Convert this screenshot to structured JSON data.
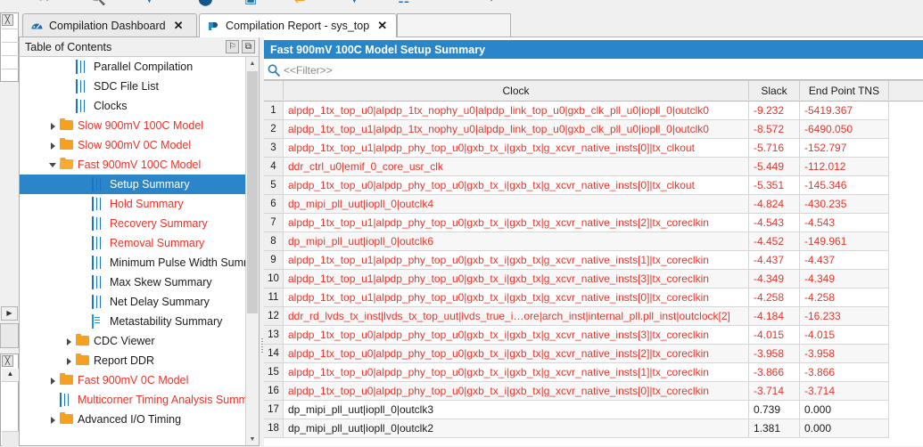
{
  "toolbar": {
    "icons": [
      "cursor-icon",
      "zoom-icon",
      "down-arrow-icon",
      "circle-icon",
      "chart-icon",
      "compare-icon",
      "down-arrow-2-icon",
      "report-icon",
      "more-icon",
      "pointer-icon"
    ]
  },
  "tabs": [
    {
      "label": "Compilation Dashboard",
      "icon": "dashboard-icon",
      "close": "✕",
      "active": false
    },
    {
      "label": "Compilation Report - sys_top",
      "icon": "report-icon",
      "close": "✕",
      "active": true
    }
  ],
  "toc": {
    "title": "Table of Contents",
    "pin_label": "⚐",
    "detach_label": "⧉",
    "items": [
      {
        "label": "Parallel Compilation",
        "icon": "table-icon",
        "indent": 2,
        "twisty": "none",
        "red": false,
        "selected": false
      },
      {
        "label": "SDC File List",
        "icon": "table-icon",
        "indent": 2,
        "twisty": "none",
        "red": false,
        "selected": false
      },
      {
        "label": "Clocks",
        "icon": "table-icon",
        "indent": 2,
        "twisty": "none",
        "red": false,
        "selected": false
      },
      {
        "label": "Slow 900mV 100C Model",
        "icon": "folder-icon",
        "indent": 1,
        "twisty": "collapsed",
        "red": true,
        "selected": false
      },
      {
        "label": "Slow 900mV 0C Model",
        "icon": "folder-icon",
        "indent": 1,
        "twisty": "collapsed",
        "red": true,
        "selected": false
      },
      {
        "label": "Fast 900mV 100C Model",
        "icon": "folder-open-icon",
        "indent": 1,
        "twisty": "expanded",
        "red": true,
        "selected": false
      },
      {
        "label": "Setup Summary",
        "icon": "table-icon",
        "indent": 3,
        "twisty": "none",
        "red": true,
        "selected": true
      },
      {
        "label": "Hold Summary",
        "icon": "table-icon",
        "indent": 3,
        "twisty": "none",
        "red": true,
        "selected": false
      },
      {
        "label": "Recovery Summary",
        "icon": "table-icon",
        "indent": 3,
        "twisty": "none",
        "red": true,
        "selected": false
      },
      {
        "label": "Removal Summary",
        "icon": "table-icon",
        "indent": 3,
        "twisty": "none",
        "red": true,
        "selected": false
      },
      {
        "label": "Minimum Pulse Width Summary",
        "icon": "table-icon",
        "indent": 3,
        "twisty": "none",
        "red": false,
        "selected": false
      },
      {
        "label": "Max Skew Summary",
        "icon": "table-icon",
        "indent": 3,
        "twisty": "none",
        "red": false,
        "selected": false
      },
      {
        "label": "Net Delay Summary",
        "icon": "table-icon",
        "indent": 3,
        "twisty": "none",
        "red": false,
        "selected": false
      },
      {
        "label": "Metastability Summary",
        "icon": "document-icon",
        "indent": 3,
        "twisty": "none",
        "red": false,
        "selected": false
      },
      {
        "label": "CDC Viewer",
        "icon": "folder-icon",
        "indent": 2,
        "twisty": "collapsed",
        "red": false,
        "selected": false
      },
      {
        "label": "Report DDR",
        "icon": "folder-icon",
        "indent": 2,
        "twisty": "collapsed",
        "red": false,
        "selected": false
      },
      {
        "label": "Fast 900mV 0C Model",
        "icon": "folder-icon",
        "indent": 1,
        "twisty": "collapsed",
        "red": true,
        "selected": false
      },
      {
        "label": "Multicorner Timing Analysis Summary",
        "icon": "table-icon",
        "indent": 1,
        "twisty": "none",
        "red": true,
        "selected": false
      },
      {
        "label": "Advanced I/O Timing",
        "icon": "folder-icon",
        "indent": 1,
        "twisty": "collapsed",
        "red": false,
        "selected": false
      }
    ]
  },
  "report": {
    "title": "Fast 900mV 100C Model Setup Summary",
    "filter_placeholder": "<<Filter>>",
    "search_icon": "search-icon",
    "columns": [
      "",
      "Clock",
      "Slack",
      "End Point TNS",
      ""
    ],
    "rows": [
      {
        "n": "1",
        "clock": "alpdp_1tx_top_u0|alpdp_1tx_nophy_u0|alpdp_link_top_u0|gxb_clk_pll_u0|iopll_0|outclk0",
        "slack": "-9.232",
        "tns": "-5419.367",
        "neg": true
      },
      {
        "n": "2",
        "clock": "alpdp_1tx_top_u1|alpdp_1tx_nophy_u0|alpdp_link_top_u0|gxb_clk_pll_u0|iopll_0|outclk0",
        "slack": "-8.572",
        "tns": "-6490.050",
        "neg": true
      },
      {
        "n": "3",
        "clock": "alpdp_1tx_top_u1|alpdp_phy_top_u0|gxb_tx_i|gxb_tx|g_xcvr_native_insts[0]|tx_clkout",
        "slack": "-5.716",
        "tns": "-152.797",
        "neg": true
      },
      {
        "n": "4",
        "clock": "ddr_ctrl_u0|emif_0_core_usr_clk",
        "slack": "-5.449",
        "tns": "-112.012",
        "neg": true
      },
      {
        "n": "5",
        "clock": "alpdp_1tx_top_u0|alpdp_phy_top_u0|gxb_tx_i|gxb_tx|g_xcvr_native_insts[0]|tx_clkout",
        "slack": "-5.351",
        "tns": "-145.346",
        "neg": true
      },
      {
        "n": "6",
        "clock": "dp_mipi_pll_uut|iopll_0|outclk4",
        "slack": "-4.824",
        "tns": "-430.235",
        "neg": true
      },
      {
        "n": "7",
        "clock": "alpdp_1tx_top_u1|alpdp_phy_top_u0|gxb_tx_i|gxb_tx|g_xcvr_native_insts[2]|tx_coreclkin",
        "slack": "-4.543",
        "tns": "-4.543",
        "neg": true
      },
      {
        "n": "8",
        "clock": "dp_mipi_pll_uut|iopll_0|outclk6",
        "slack": "-4.452",
        "tns": "-149.961",
        "neg": true
      },
      {
        "n": "9",
        "clock": "alpdp_1tx_top_u1|alpdp_phy_top_u0|gxb_tx_i|gxb_tx|g_xcvr_native_insts[1]|tx_coreclkin",
        "slack": "-4.437",
        "tns": "-4.437",
        "neg": true
      },
      {
        "n": "10",
        "clock": "alpdp_1tx_top_u1|alpdp_phy_top_u0|gxb_tx_i|gxb_tx|g_xcvr_native_insts[3]|tx_coreclkin",
        "slack": "-4.349",
        "tns": "-4.349",
        "neg": true
      },
      {
        "n": "11",
        "clock": "alpdp_1tx_top_u1|alpdp_phy_top_u0|gxb_tx_i|gxb_tx|g_xcvr_native_insts[0]|tx_coreclkin",
        "slack": "-4.258",
        "tns": "-4.258",
        "neg": true
      },
      {
        "n": "12",
        "clock": "ddr_rd_lvds_tx_inst|lvds_tx_top_uut|lvds_true_i…ore|arch_inst|internal_pll.pll_inst|outclock[2]",
        "slack": "-4.184",
        "tns": "-16.233",
        "neg": true
      },
      {
        "n": "13",
        "clock": "alpdp_1tx_top_u0|alpdp_phy_top_u0|gxb_tx_i|gxb_tx|g_xcvr_native_insts[3]|tx_coreclkin",
        "slack": "-4.015",
        "tns": "-4.015",
        "neg": true
      },
      {
        "n": "14",
        "clock": "alpdp_1tx_top_u0|alpdp_phy_top_u0|gxb_tx_i|gxb_tx|g_xcvr_native_insts[2]|tx_coreclkin",
        "slack": "-3.958",
        "tns": "-3.958",
        "neg": true
      },
      {
        "n": "15",
        "clock": "alpdp_1tx_top_u0|alpdp_phy_top_u0|gxb_tx_i|gxb_tx|g_xcvr_native_insts[1]|tx_coreclkin",
        "slack": "-3.866",
        "tns": "-3.866",
        "neg": true
      },
      {
        "n": "16",
        "clock": "alpdp_1tx_top_u0|alpdp_phy_top_u0|gxb_tx_i|gxb_tx|g_xcvr_native_insts[0]|tx_coreclkin",
        "slack": "-3.714",
        "tns": "-3.714",
        "neg": true
      },
      {
        "n": "17",
        "clock": "dp_mipi_pll_uut|iopll_0|outclk3",
        "slack": "0.739",
        "tns": "0.000",
        "neg": false
      },
      {
        "n": "18",
        "clock": "dp_mipi_pll_uut|iopll_0|outclk2",
        "slack": "1.381",
        "tns": "0.000",
        "neg": false
      }
    ]
  },
  "colors": {
    "accent": "#2a86c8",
    "negative_slack": "#e8352b",
    "normal_text": "#1a1a1a",
    "folder": "#f5a01e"
  }
}
